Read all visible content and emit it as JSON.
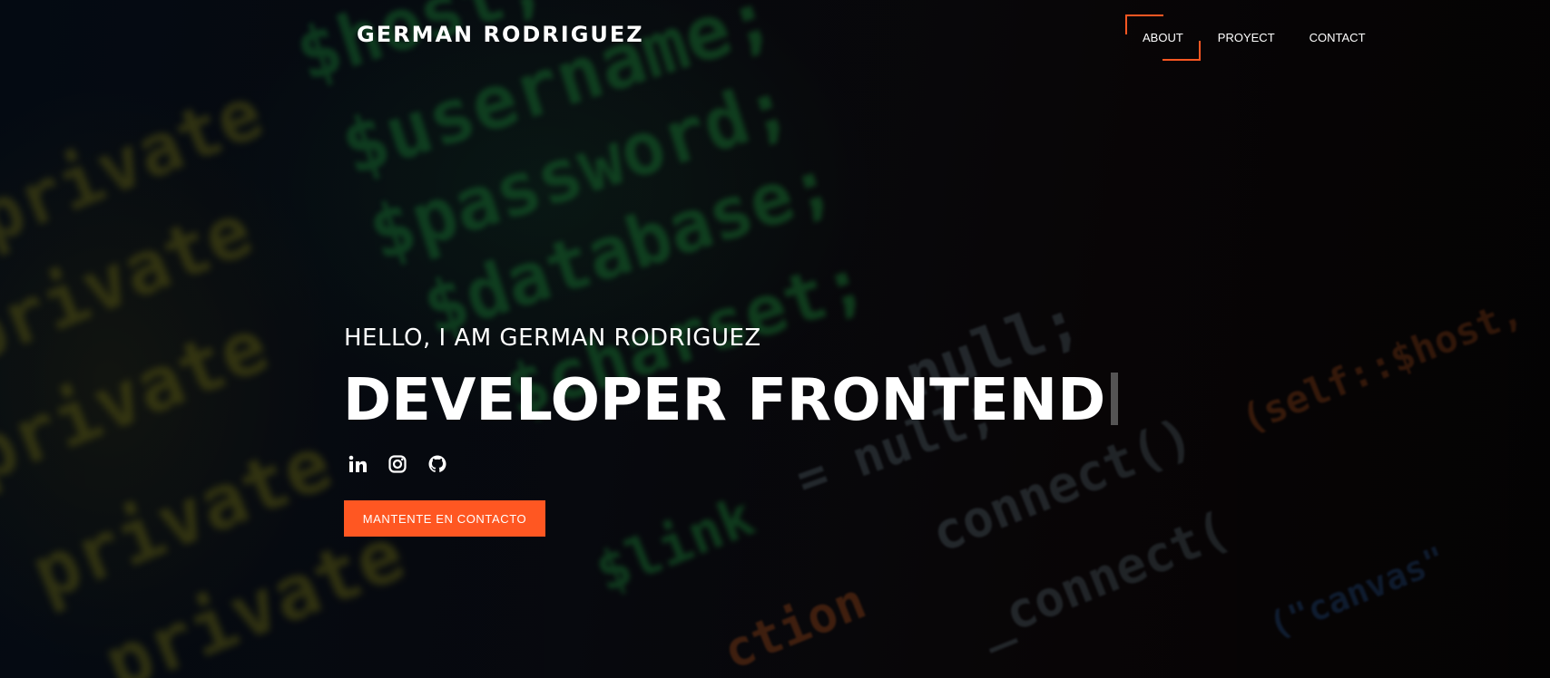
{
  "header": {
    "brand": "GERMAN RODRIGUEZ",
    "nav": [
      {
        "label": "ABOUT",
        "active": true
      },
      {
        "label": "PROYECT",
        "active": false
      },
      {
        "label": "CONTACT",
        "active": false
      }
    ]
  },
  "hero": {
    "greeting": "HELLO, I AM GERMAN RODRIGUEZ",
    "title": "DEVELOPER FRONTEND",
    "socials": [
      "linkedin-icon",
      "instagram-icon",
      "github-icon"
    ],
    "cta_label": "MANTENTE EN CONTACTO"
  },
  "colors": {
    "accent": "#ff5722",
    "text": "#ffffff",
    "background": "#07070d"
  }
}
